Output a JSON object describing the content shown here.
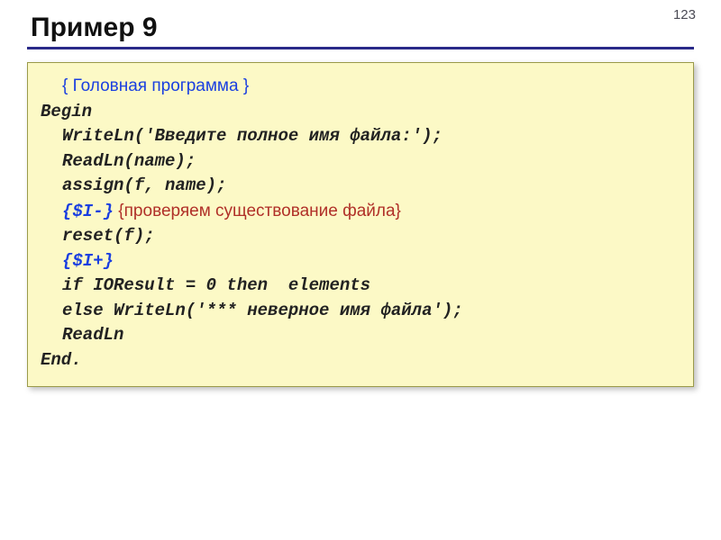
{
  "page_number": "123",
  "title": "Пример 9",
  "code": {
    "l1_comment": "{ Головная программа }",
    "l2": "Begin",
    "l3": "WriteLn('Введите полное имя файла:');",
    "l4": "ReadLn(name);",
    "l5": "assign(f, name);",
    "l6a": "{$I-}",
    "l6b_comment": " {проверяем существование файла}",
    "l7": "reset(f);",
    "l8": "{$I+}",
    "l9": "if IOResult = 0 then  elements",
    "l10": "else WriteLn('*** неверное имя файла');",
    "l11": "ReadLn",
    "l12": "End."
  }
}
